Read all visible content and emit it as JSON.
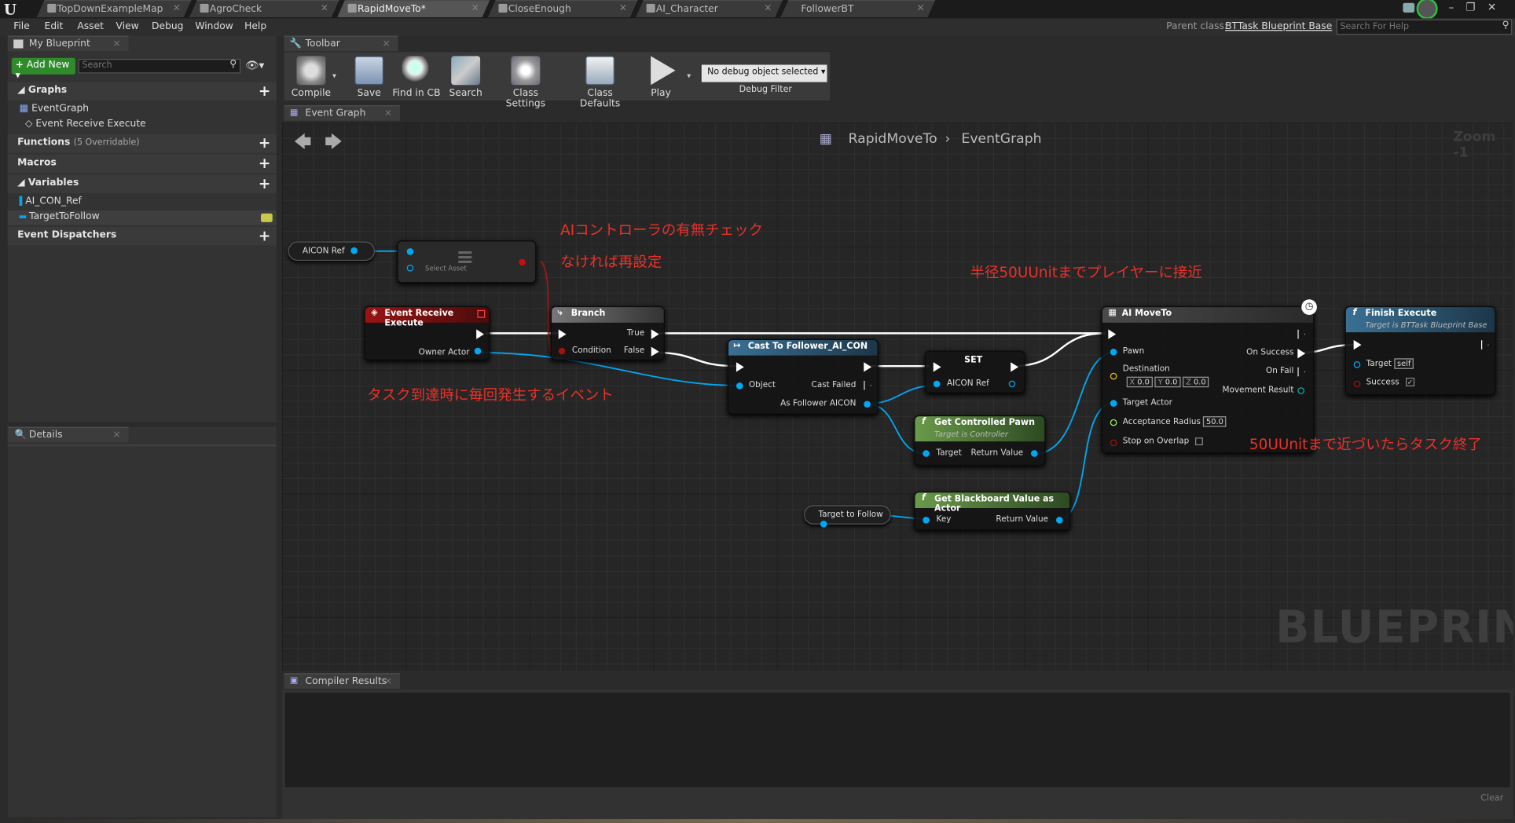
{
  "tabs": [
    {
      "label": "TopDownExampleMap"
    },
    {
      "label": "AgroCheck"
    },
    {
      "label": "RapidMoveTo*"
    },
    {
      "label": "CloseEnough"
    },
    {
      "label": "AI_Character"
    },
    {
      "label": "FollowerBT"
    }
  ],
  "menu": [
    "File",
    "Edit",
    "Asset",
    "View",
    "Debug",
    "Window",
    "Help"
  ],
  "parent_class": {
    "label": "Parent class:",
    "value": "BTTask Blueprint Base"
  },
  "help_search": {
    "placeholder": "Search For Help"
  },
  "my_blueprint": {
    "tab": "My Blueprint",
    "add_new": "Add New",
    "search_placeholder": "Search",
    "graphs_label": "Graphs",
    "event_graph": "EventGraph",
    "event_item": "Event Receive Execute",
    "functions_label": "Functions",
    "functions_count": "(5 Overridable)",
    "macros_label": "Macros",
    "variables_label": "Variables",
    "variables": [
      "AI_CON_Ref",
      "TargetToFollow"
    ],
    "dispatchers_label": "Event Dispatchers"
  },
  "details": {
    "tab": "Details"
  },
  "toolbar": {
    "tab": "Toolbar",
    "buttons": [
      "Compile",
      "Save",
      "Find in CB",
      "Search",
      "Class Settings",
      "Class Defaults",
      "Play"
    ],
    "debug_select": "No debug object selected",
    "debug_filter": "Debug Filter"
  },
  "graph": {
    "tab": "Event Graph",
    "breadcrumb_bp": "RapidMoveTo",
    "breadcrumb_graph": "EventGraph",
    "zoom": "Zoom -1",
    "watermark": "BLUEPRINT"
  },
  "nodes": {
    "aicon_ref_get": "AICON Ref",
    "select_label": "Select Asset",
    "event": {
      "title": "Event Receive Execute",
      "owner": "Owner Actor"
    },
    "branch": {
      "title": "Branch",
      "condition": "Condition",
      "true": "True",
      "false": "False"
    },
    "cast": {
      "title": "Cast To Follower_AI_CON",
      "object": "Object",
      "failed": "Cast Failed",
      "as": "As Follower AICON"
    },
    "set": {
      "title": "SET",
      "pin": "AICON Ref"
    },
    "pawn": {
      "title": "Get Controlled Pawn",
      "sub": "Target is Controller",
      "target": "Target",
      "ret": "Return Value"
    },
    "target_var": "Target to Follow",
    "bb": {
      "title": "Get Blackboard Value as Actor",
      "key": "Key",
      "ret": "Return Value"
    },
    "move": {
      "title": "AI MoveTo",
      "pawn": "Pawn",
      "destination": "Destination",
      "x": "X",
      "xv": "0.0",
      "y": "Y",
      "yv": "0.0",
      "z": "Z",
      "zv": "0.0",
      "target_actor": "Target Actor",
      "radius": "Acceptance Radius",
      "radius_v": "50.0",
      "overlap": "Stop on Overlap",
      "on_success": "On Success",
      "on_fail": "On Fail",
      "result": "Movement Result"
    },
    "finish": {
      "title": "Finish Execute",
      "sub": "Target is BTTask Blueprint Base",
      "target": "Target",
      "self": "self",
      "success": "Success"
    }
  },
  "notes": {
    "n1": "AIコントローラの有無チェック",
    "n2": "なければ再設定",
    "n3": "半径50UUnitまでプレイヤーに接近",
    "n4": "タスク到達時に毎回発生するイベント",
    "n5": "50UUnitまで近づいたらタスク終了"
  },
  "compiler": {
    "tab": "Compiler Results",
    "clear": "Clear"
  },
  "colors": {
    "accent": "#e8322a",
    "exec_wire": "#ffffff",
    "object_wire": "#00a8f4",
    "event_header": "#8a1111",
    "func_header": "#3a7094",
    "pure_header": "#6a9a4a"
  }
}
